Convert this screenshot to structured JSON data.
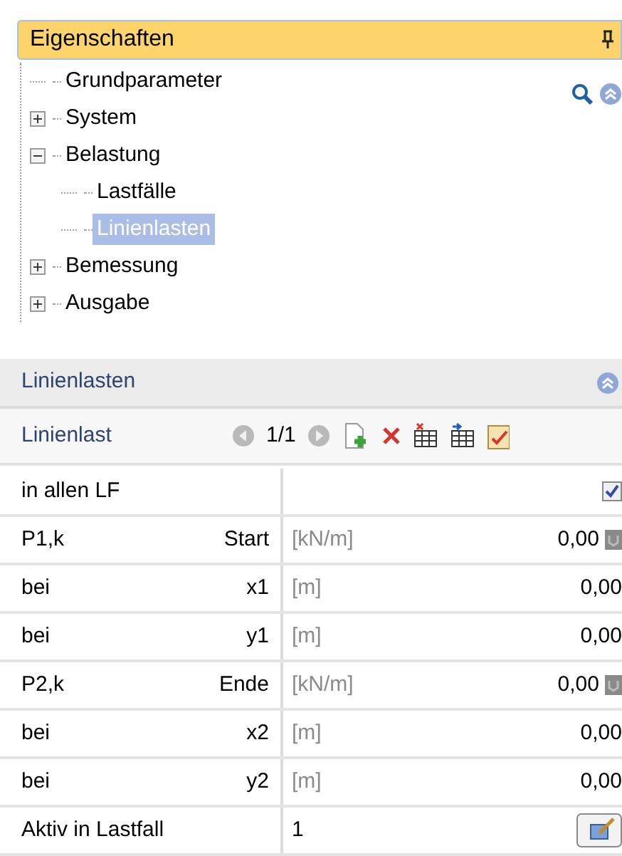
{
  "panel_title": "Eigenschaften",
  "tree": [
    {
      "label": "Grundparameter",
      "selected": false
    },
    {
      "label": "System",
      "expanded": false,
      "selected": false
    },
    {
      "label": "Belastung",
      "expanded": true,
      "selected": false,
      "children": [
        {
          "label": "Lastfälle",
          "selected": false
        },
        {
          "label": "Linienlasten",
          "selected": true
        }
      ]
    },
    {
      "label": "Bemessung",
      "expanded": false,
      "selected": false
    },
    {
      "label": "Ausgabe",
      "expanded": false,
      "selected": false
    }
  ],
  "section": {
    "title": "Linienlasten"
  },
  "toolbar": {
    "label": "Linienlast",
    "counter": "1/1"
  },
  "rows": [
    {
      "kind": "checkbox",
      "label": "in allen LF",
      "checked": true
    },
    {
      "kind": "value",
      "label": "P1,k",
      "sublabel": "Start",
      "unit": "[kN/m]",
      "value": "0,00",
      "button": true
    },
    {
      "kind": "value",
      "label": "bei",
      "sublabel": "x1",
      "unit": "[m]",
      "value": "0,00",
      "button": false
    },
    {
      "kind": "value",
      "label": "bei",
      "sublabel": "y1",
      "unit": "[m]",
      "value": "0,00",
      "button": false
    },
    {
      "kind": "value",
      "label": "P2,k",
      "sublabel": "Ende",
      "unit": "[kN/m]",
      "value": "0,00",
      "button": true
    },
    {
      "kind": "value",
      "label": "bei",
      "sublabel": "x2",
      "unit": "[m]",
      "value": "0,00",
      "button": false
    },
    {
      "kind": "value",
      "label": "bei",
      "sublabel": "y2",
      "unit": "[m]",
      "value": "0,00",
      "button": false
    },
    {
      "kind": "edit",
      "label": "Aktiv in Lastfall",
      "value": "1"
    }
  ]
}
